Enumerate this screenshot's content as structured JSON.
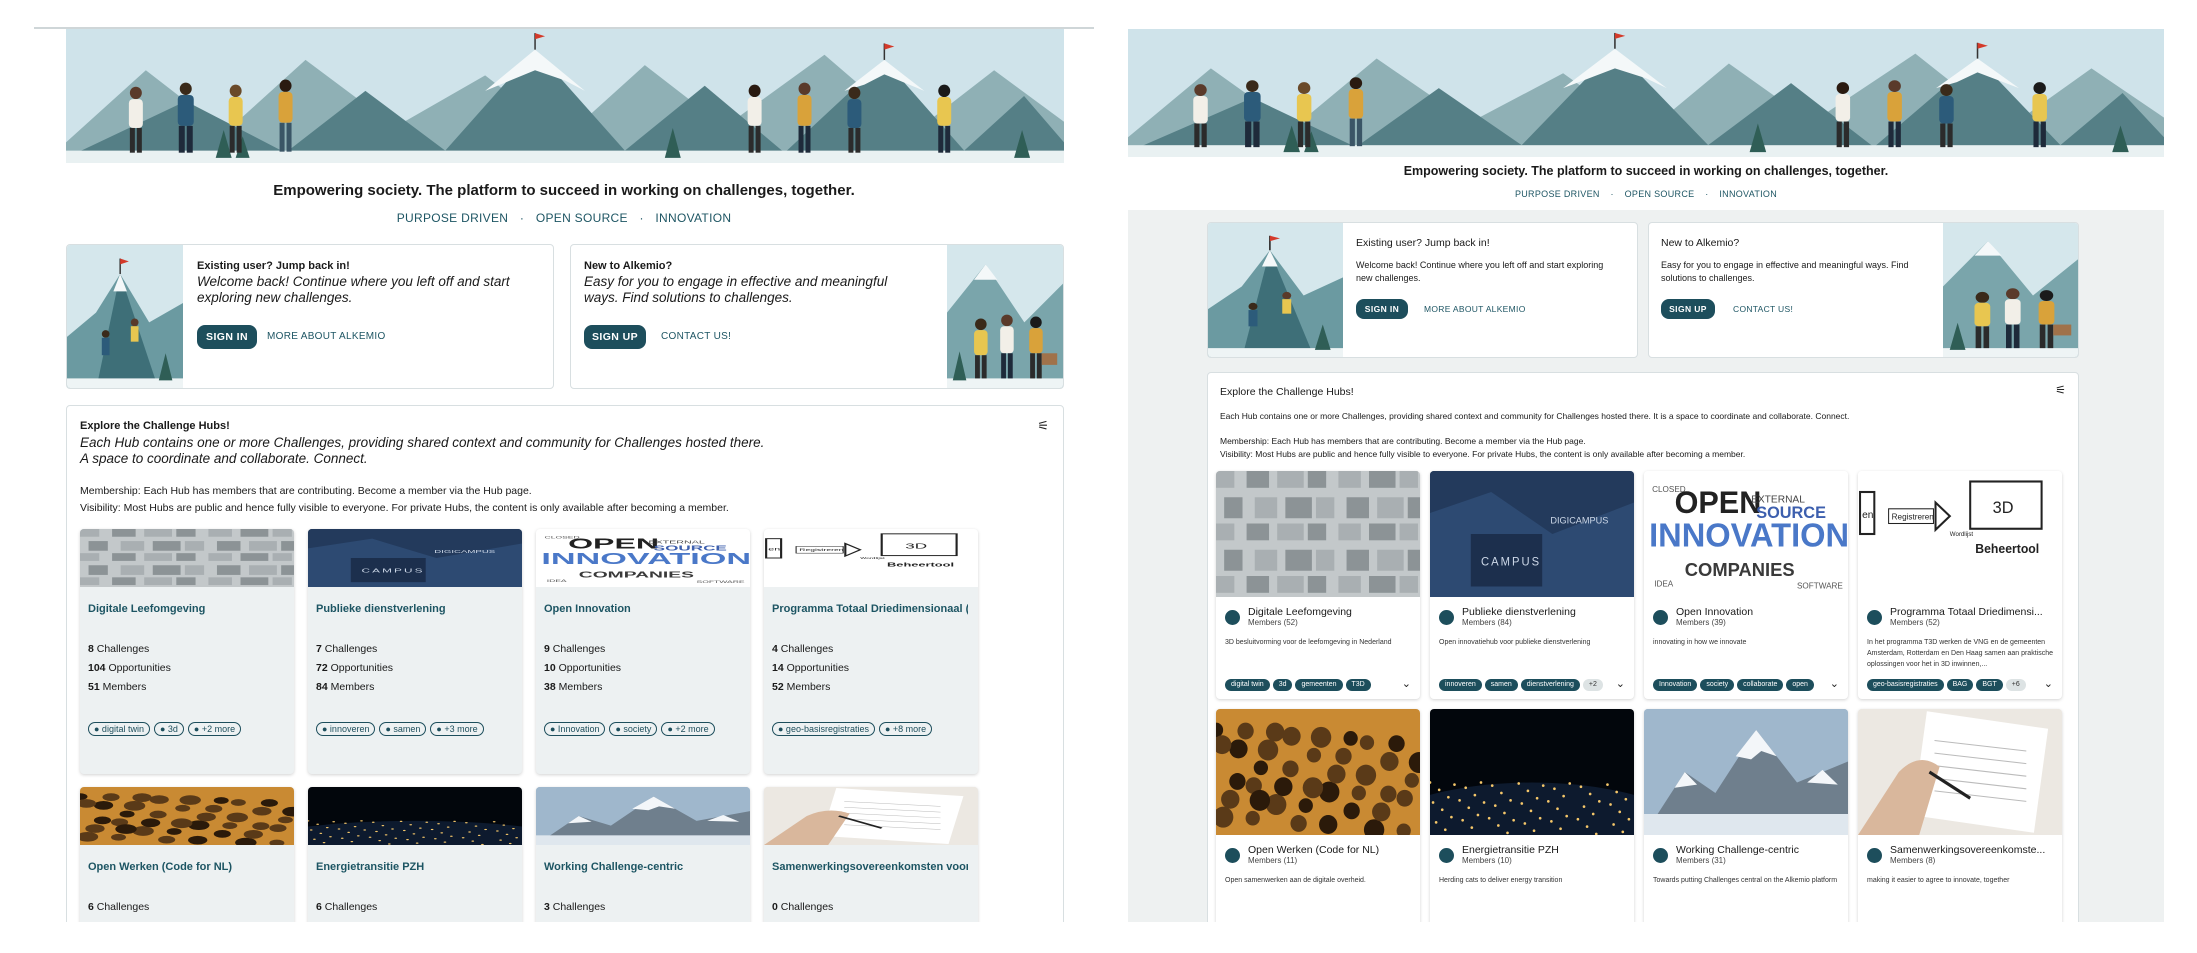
{
  "tagline": "Empowering society. The platform to succeed in working on challenges, together.",
  "pillars": [
    "PURPOSE DRIVEN",
    "OPEN SOURCE",
    "INNOVATION"
  ],
  "pillar_sep": "·",
  "existing_user": {
    "title": "Existing user? Jump back in!",
    "text": "Welcome back! Continue where you left off and start exploring new challenges.",
    "primary": "SIGN IN",
    "secondary": "MORE ABOUT ALKEMIO"
  },
  "new_user": {
    "title": "New to Alkemio?",
    "text": "Easy for you to engage in effective and meaningful ways. Find solutions to challenges.",
    "primary": "SIGN UP",
    "secondary": "CONTACT US!"
  },
  "explore": {
    "title": "Explore the Challenge Hubs!",
    "intro": "Each Hub contains one or more Challenges, providing shared context and community for Challenges hosted there.",
    "intro2": "A space to coordinate and collaborate. Connect.",
    "intro_full": "Each Hub contains one or more Challenges, providing shared context and community for Challenges hosted there. It is a space to coordinate and collaborate. Connect.",
    "membership": "Membership: Each Hub has members that are contributing. Become a member via the Hub page.",
    "visibility": "Visibility: Most Hubs are public and hence fully visible to everyone. For private Hubs, the content is only available after becoming a member."
  },
  "labels": {
    "challenges": "Challenges",
    "opportunities": "Opportunities",
    "members": "Members"
  },
  "hubs_left": [
    {
      "name": "Digitale Leefomgeving",
      "challenges": "8",
      "opportunities": "104",
      "members": "51",
      "tags": [
        "digital twin",
        "3d",
        "+2 more"
      ]
    },
    {
      "name": "Publieke dienstverlening",
      "challenges": "7",
      "opportunities": "72",
      "members": "84",
      "tags": [
        "innoveren",
        "samen",
        "+3 more"
      ]
    },
    {
      "name": "Open Innovation",
      "challenges": "9",
      "opportunities": "10",
      "members": "38",
      "tags": [
        "Innovation",
        "society",
        "+2 more"
      ]
    },
    {
      "name": "Programma Totaal Driedimensionaal (T...",
      "challenges": "4",
      "opportunities": "14",
      "members": "52",
      "tags": [
        "geo-basisregistraties",
        "+8 more"
      ]
    },
    {
      "name": "Open Werken (Code for NL)",
      "challenges": "6"
    },
    {
      "name": "Energietransitie PZH",
      "challenges": "6"
    },
    {
      "name": "Working Challenge-centric",
      "challenges": "3"
    },
    {
      "name": "Samenwerkingsovereenkomsten voor I...",
      "challenges": "0"
    }
  ],
  "hubs_right": [
    {
      "name": "Digitale Leefomgeving",
      "members": "Members (52)",
      "desc": "3D besluitvorming voor de leefomgeving in Nederland",
      "tags": [
        "digital twin",
        "3d",
        "gemeenten",
        "T3D"
      ]
    },
    {
      "name": "Publieke dienstverlening",
      "members": "Members (84)",
      "desc": "Open innovatiehub voor publieke dienstverlening",
      "tags": [
        "innoveren",
        "samen",
        "dienstverlening",
        "+2"
      ]
    },
    {
      "name": "Open Innovation",
      "members": "Members (39)",
      "desc": "innovating in how we innovate",
      "tags": [
        "Innovation",
        "society",
        "collaborate",
        "open"
      ]
    },
    {
      "name": "Programma Totaal Driedimensi...",
      "members": "Members (52)",
      "desc": "In het programma T3D werken de VNG en de gemeenten Amsterdam, Rotterdam en Den Haag samen aan praktische oplossingen voor het in 3D inwinnen,...",
      "tags": [
        "geo-basisregistraties",
        "BAG",
        "BGT",
        "+6"
      ]
    },
    {
      "name": "Open Werken (Code for NL)",
      "members": "Members (11)",
      "desc": "Open samenwerken aan de digitale overheid."
    },
    {
      "name": "Energietransitie PZH",
      "members": "Members (10)",
      "desc": "Herding cats to deliver energy transition"
    },
    {
      "name": "Working Challenge-centric",
      "members": "Members (31)",
      "desc": "Towards putting Challenges central on the Alkemio platform"
    },
    {
      "name": "Samenwerkingsovereenkomste...",
      "members": "Members (8)",
      "desc": "making it easier to agree to innovate, together"
    }
  ],
  "img_text": {
    "campus": "CAMPUS",
    "digicampus": "DIGICAMPUS",
    "open": "OPEN",
    "innovation": "INNOVATION",
    "source": "SOURCE",
    "companies": "COMPANIES",
    "external": "EXTERNAL",
    "closed": "CLOSED",
    "software": "SOFTWARE",
    "idea": "IDEA",
    "registreren": "Registreren",
    "three_d": "3D",
    "beheertool": "Beheertool",
    "wordlijst": "Wordlijst",
    "en": "en"
  }
}
